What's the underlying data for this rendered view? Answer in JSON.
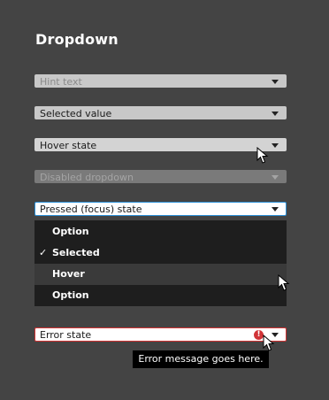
{
  "page": {
    "title": "Dropdown"
  },
  "dropdowns": {
    "hint": {
      "text": "Hint text"
    },
    "selected": {
      "text": "Selected value"
    },
    "hover": {
      "text": "Hover state"
    },
    "disabled": {
      "text": "Disabled dropdown"
    },
    "pressed": {
      "text": "Pressed (focus) state"
    },
    "error": {
      "text": "Error state",
      "icon": "!"
    }
  },
  "menu": {
    "options": [
      {
        "label": "Option",
        "selected": false,
        "hover": false
      },
      {
        "label": "Selected",
        "selected": true,
        "hover": false
      },
      {
        "label": "Hover",
        "selected": false,
        "hover": true
      },
      {
        "label": "Option",
        "selected": false,
        "hover": false
      }
    ],
    "check_glyph": "✓"
  },
  "tooltip": {
    "text": "Error message goes here."
  },
  "icons": {
    "dropdown_arrow": "chevron-down-icon",
    "check": "check-icon",
    "error": "error-icon",
    "cursor": "cursor-icon"
  },
  "colors": {
    "background": "#444444",
    "focus_border": "#2b8fd6",
    "error_border": "#d23333",
    "error_icon": "#d13438",
    "menu_background": "#1e1e1e"
  }
}
